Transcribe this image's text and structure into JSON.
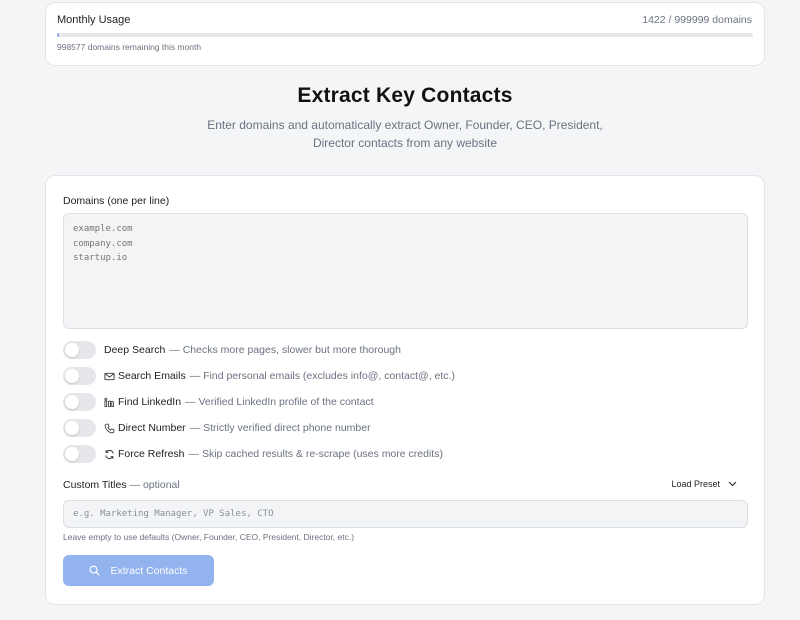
{
  "usage": {
    "title": "Monthly Usage",
    "count": "1422 / 999999 domains",
    "remaining": "998577 domains remaining this month",
    "used_fraction": 0.00142
  },
  "hero": {
    "title": "Extract Key Contacts",
    "subtitle": "Enter domains and automatically extract Owner, Founder, CEO, President, Director contacts from any website"
  },
  "form": {
    "domains_label": "Domains (one per line)",
    "domains_placeholder": "example.com\ncompany.com\nstartup.io",
    "toggles": [
      {
        "label": "Deep Search",
        "desc": "— Checks more pages, slower but more thorough",
        "icon": "none"
      },
      {
        "label": "Search Emails",
        "desc": "— Find personal emails (excludes info@, contact@, etc.)",
        "icon": "mail-icon"
      },
      {
        "label": "Find LinkedIn",
        "desc": "— Verified LinkedIn profile of the contact",
        "icon": "linkedin-icon"
      },
      {
        "label": "Direct Number",
        "desc": "— Strictly verified direct phone number",
        "icon": "phone-icon"
      },
      {
        "label": "Force Refresh",
        "desc": "— Skip cached results & re-scrape (uses more credits)",
        "icon": "refresh-icon"
      }
    ],
    "titles_label": "Custom Titles",
    "titles_optional": "— optional",
    "load_preset": "Load Preset",
    "titles_placeholder": "e.g. Marketing Manager, VP Sales, CTO",
    "titles_hint": "Leave empty to use defaults (Owner, Founder, CEO, President, Director, etc.)",
    "submit_label": "Extract Contacts"
  },
  "colors": {
    "accent": "#93b3ee",
    "progress": "#8ea7f0",
    "background": "#f4f5f7"
  }
}
